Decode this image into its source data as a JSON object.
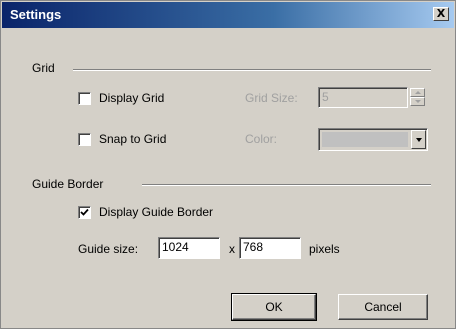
{
  "window": {
    "title": "Settings",
    "close_glyph": "X"
  },
  "grid": {
    "group_label": "Grid",
    "display_grid": {
      "label": "Display Grid",
      "checked": false
    },
    "snap_to_grid": {
      "label": "Snap to Grid",
      "checked": false
    },
    "grid_size": {
      "label": "Grid Size:",
      "value": "5"
    },
    "color": {
      "label": "Color:"
    }
  },
  "guide_border": {
    "group_label": "Guide Border",
    "display_guide_border": {
      "label": "Display Guide Border",
      "checked": true
    },
    "guide_size_label": "Guide size:",
    "width": "1024",
    "separator": "x",
    "height": "768",
    "unit": "pixels"
  },
  "buttons": {
    "ok": "OK",
    "cancel": "Cancel"
  },
  "colors": {
    "titlebar_start": "#0a246a",
    "face": "#d4d0c8"
  }
}
